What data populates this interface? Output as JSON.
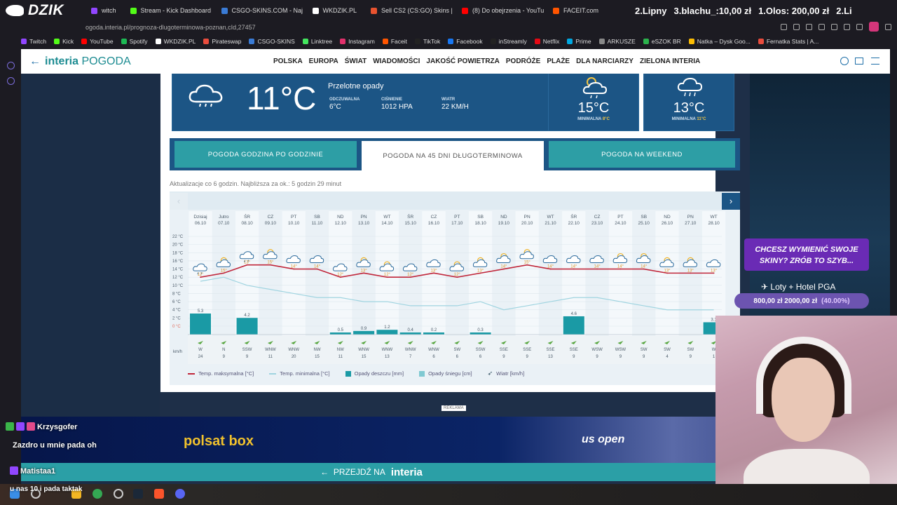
{
  "browser": {
    "logo": "DZIK",
    "tabs": [
      {
        "label": "witch",
        "color": "#9146ff"
      },
      {
        "label": "Stream - Kick Dashboard",
        "color": "#53fc18"
      },
      {
        "label": "CSGO-SKINS.COM - Naj",
        "color": "#3a7bd5"
      },
      {
        "label": "WKDZIK.PL",
        "color": "#ffffff"
      },
      {
        "label": "Sell CS2 (CS:GO) Skins |",
        "color": "#e8532f"
      },
      {
        "label": "(8) Do obejrzenia - YouTu",
        "color": "#ff0000"
      },
      {
        "label": "FACEIT.com",
        "color": "#ff5500"
      }
    ],
    "ticker": [
      "2.Lipny",
      "3.blachu_:10,00 zł",
      "1.Olos: 200,00 zł",
      "2.Li"
    ],
    "address": "ogoda.interia.pl/prognoza-dlugoterminowa-poznan,cId,27457",
    "bookmarks": [
      {
        "label": "Twitch",
        "color": "#9146ff"
      },
      {
        "label": "Kick",
        "color": "#53fc18"
      },
      {
        "label": "YouTube",
        "color": "#ff0000"
      },
      {
        "label": "Spotify",
        "color": "#1db954"
      },
      {
        "label": "WKDZIK.PL",
        "color": "#ffffff"
      },
      {
        "label": "Pirateswap",
        "color": "#e94c3d"
      },
      {
        "label": "CSGO-SKINS",
        "color": "#3a7bd5"
      },
      {
        "label": "Linktree",
        "color": "#43e55e"
      },
      {
        "label": "Instagram",
        "color": "#e1306c"
      },
      {
        "label": "Faceit",
        "color": "#ff5500"
      },
      {
        "label": "TikTok",
        "color": "#222222"
      },
      {
        "label": "Facebook",
        "color": "#1877f2"
      },
      {
        "label": "inStreamly",
        "color": "#222222"
      },
      {
        "label": "Netflix",
        "color": "#e50914"
      },
      {
        "label": "Prime",
        "color": "#00a8e1"
      },
      {
        "label": "ARKUSZE",
        "color": "#888888"
      },
      {
        "label": "eSZOK BR",
        "color": "#2bb24c"
      },
      {
        "label": "Natka – Dysk Goo...",
        "color": "#fbbc04"
      },
      {
        "label": "Fernatka Stats | A...",
        "color": "#e94c3d"
      }
    ]
  },
  "site": {
    "brand_a": "interia",
    "brand_b": "POGODA",
    "nav": [
      "POLSKA",
      "EUROPA",
      "ŚWIAT",
      "WIADOMOŚCI",
      "JAKOŚĆ POWIETRZA",
      "PODRÓŻE",
      "PLAŻE",
      "DLA NARCIARZY",
      "ZIELONA INTERIA"
    ]
  },
  "current": {
    "temp": "11°C",
    "desc": "Przelotne opady",
    "odczuwalna_label": "ODCZUWALNA",
    "odczuwalna": "6°C",
    "cisnienie_label": "CIŚNIENIE",
    "cisnienie": "1012 hPa",
    "wiatr_label": "WIATR",
    "wiatr": "22 km/h"
  },
  "forecast": [
    {
      "temp": "15°C",
      "min_label": "MINIMALNA",
      "min": "8°C"
    },
    {
      "temp": "13°C",
      "min_label": "MINIMALNA",
      "min": "11°C"
    }
  ],
  "tabs": [
    "POGODA GODZINA PO GODZINIE",
    "POGODA NA 45 DNI DŁUGOTERMINOWA",
    "POGODA NA WEEKEND"
  ],
  "update_note": "Aktualizacje co 6 godzin. Najbliższa za ok.: 5 godzin 29 minut",
  "chart_data": {
    "type": "line",
    "days": [
      "Dzisiaj",
      "Jutro",
      "ŚR",
      "CZ",
      "PT",
      "SB",
      "ND",
      "PN",
      "WT",
      "ŚR",
      "CZ",
      "PT",
      "SB",
      "ND",
      "PN",
      "WT",
      "ŚR",
      "CZ",
      "PT",
      "SB",
      "ND",
      "PN",
      "WT"
    ],
    "dates": [
      "06.10",
      "07.10",
      "08.10",
      "09.10",
      "10.10",
      "11.10",
      "12.10",
      "13.10",
      "14.10",
      "15.10",
      "16.10",
      "17.10",
      "18.10",
      "19.10",
      "20.10",
      "21.10",
      "22.10",
      "23.10",
      "24.10",
      "25.10",
      "26.10",
      "27.10",
      "28.10"
    ],
    "y_ticks": [
      "22 °C",
      "20 °C",
      "18 °C",
      "16 °C",
      "14 °C",
      "12 °C",
      "10 °C",
      "8 °C",
      "6 °C",
      "4 °C",
      "2 °C",
      "0 °C"
    ],
    "ylim": [
      0,
      22
    ],
    "temp_max": [
      12,
      13,
      15,
      15,
      14,
      14,
      12,
      13,
      12,
      12,
      13,
      12,
      13,
      14,
      15,
      14,
      14,
      14,
      14,
      14,
      13,
      13,
      13
    ],
    "temp_max_labels": [
      "12°",
      "15°",
      "13°",
      "15°",
      "14°",
      "14°",
      "12°",
      "13°",
      "12°",
      "12°",
      "13°",
      "12°",
      "13°",
      "14°",
      "15°",
      "14°",
      "14°",
      "14°",
      "14°",
      "14°",
      "13°",
      "13°",
      "13°"
    ],
    "temp_min": [
      11,
      12,
      10,
      9,
      8,
      7,
      7,
      6,
      6,
      5,
      5,
      5,
      6,
      4,
      5,
      6,
      7,
      7,
      6,
      5,
      4,
      4,
      4
    ],
    "rain": [
      5.3,
      0,
      4.2,
      0,
      0,
      0,
      0.5,
      0.9,
      1.2,
      0.4,
      0.2,
      0,
      0.3,
      0,
      0,
      0,
      4.6,
      0,
      0,
      0,
      0,
      0,
      3.1
    ],
    "rain_labels": [
      "5.3",
      "",
      "4.2",
      "",
      "",
      "",
      "0.5",
      "0.9",
      "1.2",
      "0.4",
      "0.2",
      "",
      "0.3",
      "",
      "",
      "",
      "4.6",
      "",
      "",
      "",
      "",
      "",
      "3.1"
    ],
    "weather_icons": [
      "rain-cloud-icon",
      "sun-cloud-icon",
      "rain-cloud-icon",
      "sun-cloud-icon",
      "cloud-icon",
      "cloud-icon",
      "cloud-icon",
      "sun-cloud-icon",
      "sun-cloud-icon",
      "cloud-icon",
      "cloud-icon",
      "sun-cloud-icon",
      "sun-cloud-icon",
      "sun-cloud-icon",
      "sun-cloud-icon",
      "cloud-icon",
      "cloud-icon",
      "cloud-icon",
      "sun-cloud-icon",
      "sun-cloud-icon",
      "sun-cloud-icon",
      "sun-cloud-icon",
      "cloud-icon"
    ],
    "wind_dir": [
      "W",
      "N",
      "SSW",
      "WNW",
      "WNW",
      "NW",
      "NW",
      "WNW",
      "WNW",
      "WNW",
      "WNW",
      "SW",
      "SSW",
      "SSE",
      "SSE",
      "SSE",
      "SSE",
      "WSW",
      "WSW",
      "SW",
      "SW",
      "SW",
      "W"
    ],
    "wind_speed": [
      "24",
      "9",
      "9",
      "11",
      "20",
      "15",
      "11",
      "15",
      "13",
      "7",
      "6",
      "6",
      "6",
      "9",
      "9",
      "13",
      "9",
      "9",
      "9",
      "9",
      "4",
      "9",
      "1"
    ],
    "wind_unit": "km/h",
    "series": [
      {
        "name": "Temp. maksymalna [°C]",
        "color": "#c0263a"
      },
      {
        "name": "Temp. minimalna [°C]",
        "color": "#9fd4e0"
      },
      {
        "name": "Opady deszczu [mm]",
        "color": "#1a9aa5"
      },
      {
        "name": "Opady śniegu [cm]",
        "color": "#7fc9d2"
      },
      {
        "name": "Wiatr [km/h]",
        "color": "#2f4f5f"
      }
    ]
  },
  "ad": {
    "reklama": "REKLAMA",
    "polsat": "polsat box",
    "usopen": "us open"
  },
  "przejdz": {
    "text": "PRZEJDŹ NA",
    "brand": "interia"
  },
  "overlay": {
    "promo": "CHCESZ WYMIENIĆ SWOJE SKINY? ZRÓB TO SZYB...",
    "loty": "Loty + Hotel PGA",
    "loty_amount": "800,00 zł  2000,00 zł",
    "loty_pct": "(40.00%)",
    "chat": [
      {
        "user": "Krzysgofer",
        "msg": "Zazdro u mnie pada oh"
      },
      {
        "user": "Matistaa1",
        "msg": "u nas 10 i pada taktak"
      }
    ]
  }
}
